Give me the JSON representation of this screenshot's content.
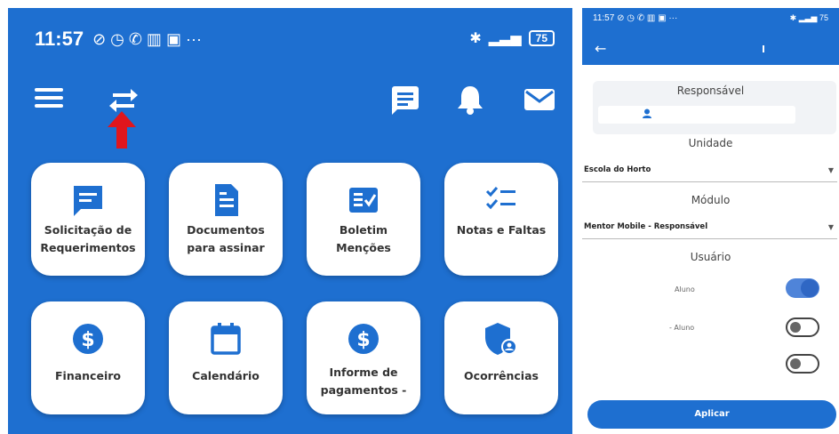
{
  "left_screen": {
    "status_time": "11:57",
    "battery": "75",
    "tiles": [
      {
        "label": "Solicitação de Requerimentos",
        "icon": "chat-icon"
      },
      {
        "label": "Documentos para assinar",
        "icon": "document-icon"
      },
      {
        "label": "Boletim Menções",
        "icon": "report-card-icon"
      },
      {
        "label": "Notas e Faltas",
        "icon": "checklist-icon"
      },
      {
        "label": "Financeiro",
        "icon": "dollar-icon"
      },
      {
        "label": "Calendário",
        "icon": "calendar-icon"
      },
      {
        "label": "Informe de pagamentos -",
        "icon": "dollar-icon"
      },
      {
        "label": "Ocorrências",
        "icon": "shield-user-icon"
      }
    ]
  },
  "right_screen": {
    "status_time": "11:57",
    "battery": "75",
    "responsavel_title": "Responsável",
    "unidade_title": "Unidade",
    "unidade_value": "Escola do Horto",
    "modulo_title": "Módulo",
    "modulo_value": "Mentor Mobile - Responsável",
    "usuario_title": "Usuário",
    "users": [
      {
        "label": "Aluno",
        "checked": true
      },
      {
        "label": "- Aluno",
        "checked": false
      },
      {
        "label": "",
        "checked": false
      }
    ],
    "apply_label": "Aplicar"
  },
  "colors": {
    "primary": "#1e6fd0",
    "annotation_red": "#e0161d",
    "tile_bg": "#ffffff"
  }
}
